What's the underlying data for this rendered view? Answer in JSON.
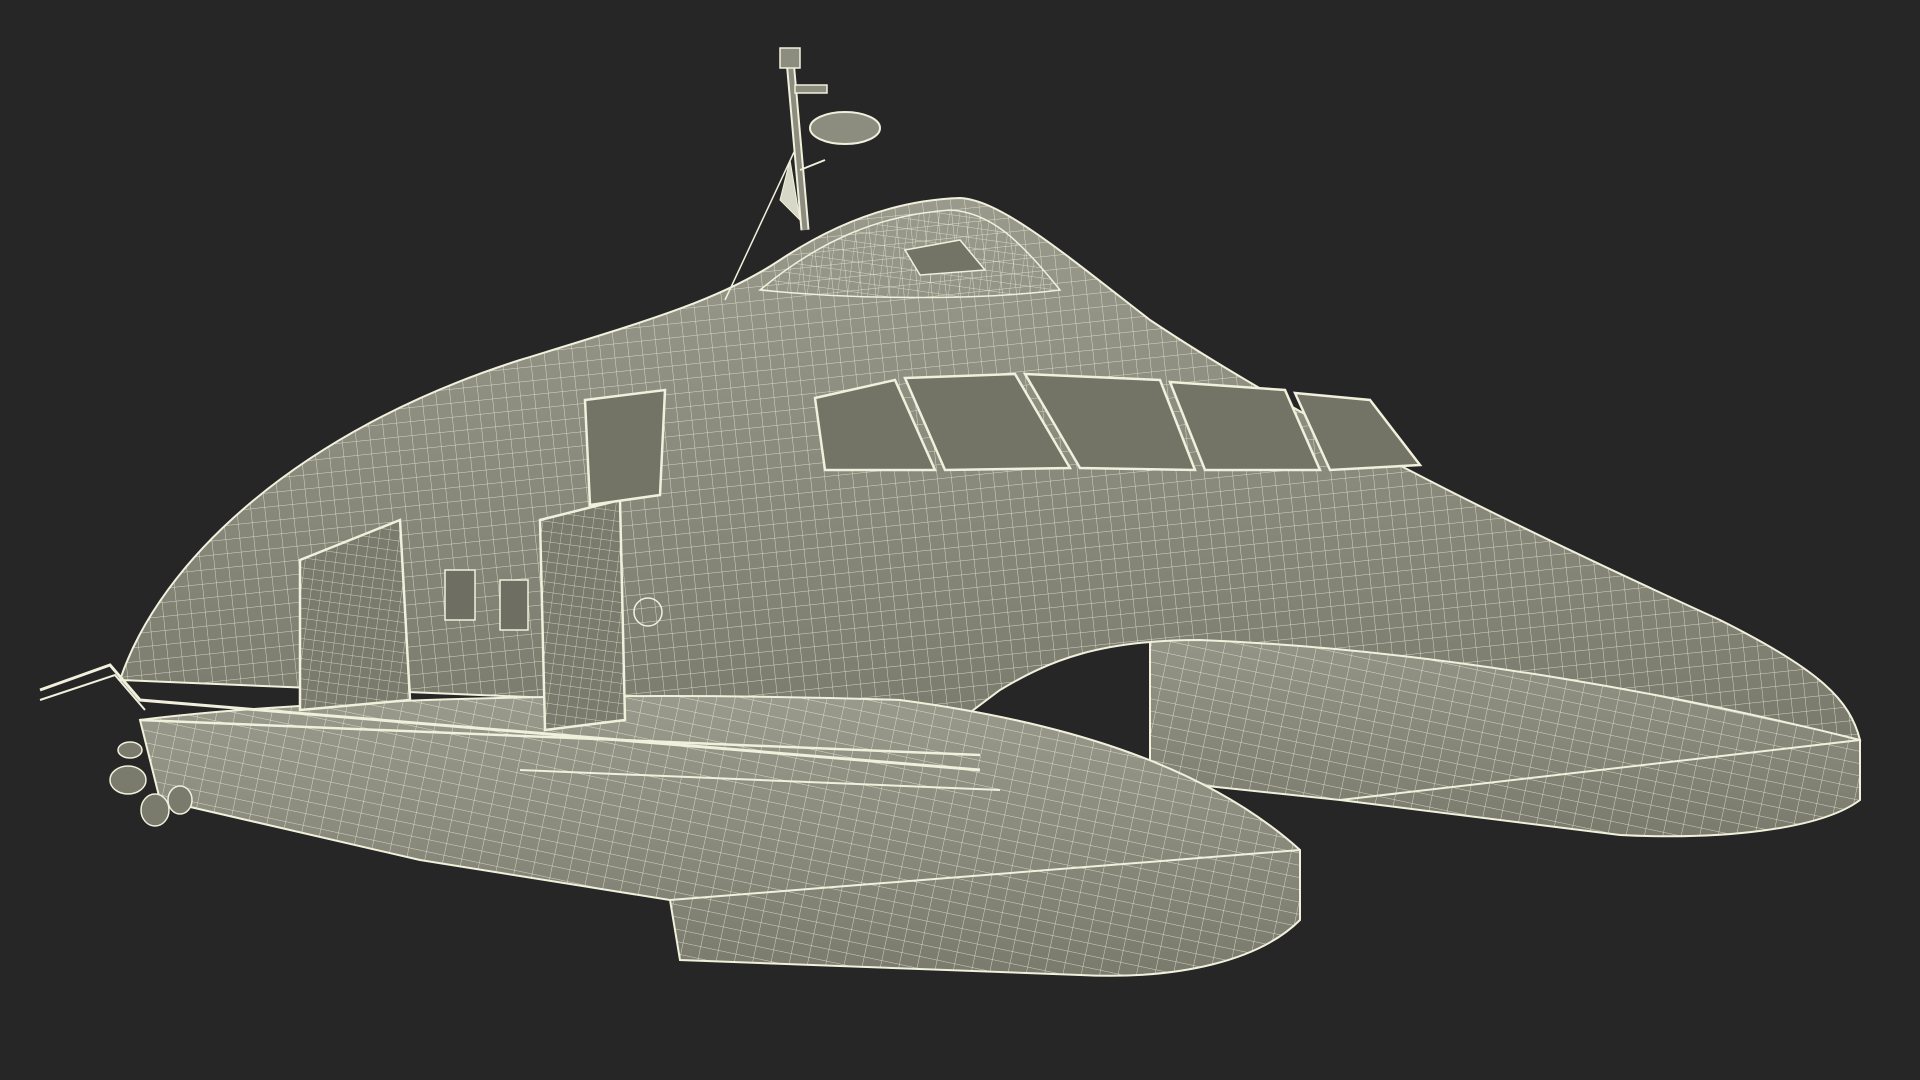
{
  "scene": {
    "background_color": "#262626",
    "surface_color": "#8d8d7f",
    "surface_shade_color": "#6e6e62",
    "wire_color": "#f0f0dc",
    "window_color": "#737366",
    "subject": "catamaran-yacht-wireframe-render"
  }
}
